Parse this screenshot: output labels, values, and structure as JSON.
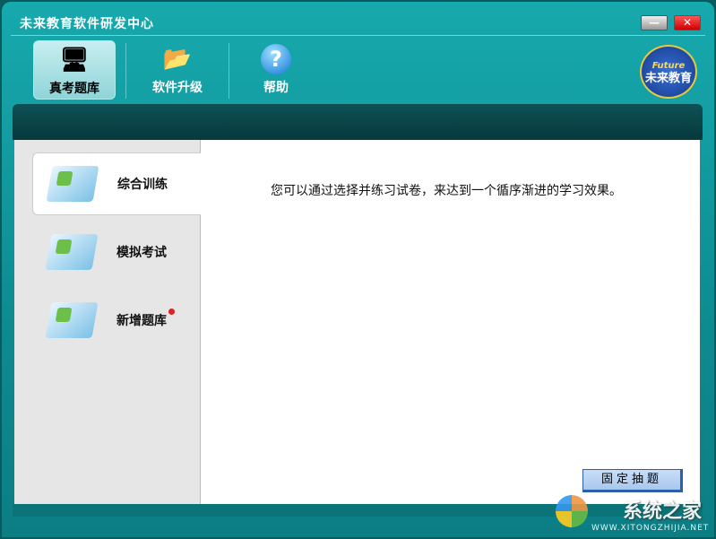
{
  "window": {
    "title": "未来教育软件研发中心",
    "minimize": "—",
    "close": "✕"
  },
  "toolbar": [
    {
      "label": "真考题库",
      "icon": "computer-icon"
    },
    {
      "label": "软件升级",
      "icon": "folder-gear-icon"
    },
    {
      "label": "帮助",
      "icon": "help-icon",
      "glyph": "?"
    }
  ],
  "logo": {
    "en": "Future",
    "cn": "未来教育"
  },
  "sidebar": [
    {
      "label": "综合训练"
    },
    {
      "label": "模拟考试"
    },
    {
      "label": "新增题库",
      "badge": true
    }
  ],
  "main": {
    "description": "您可以通过选择并练习试卷，来达到一个循序渐进的学习效果。",
    "button": "固定抽题"
  },
  "watermark": {
    "text": "系统之家",
    "url": "WWW.XITONGZHIJIA.NET"
  }
}
